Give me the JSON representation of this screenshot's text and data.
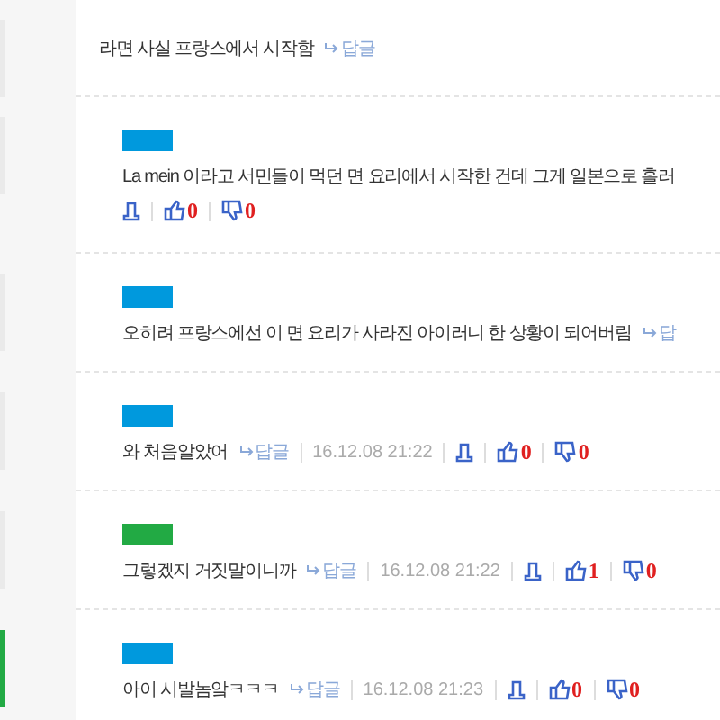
{
  "comments": [
    {
      "kind": "inline",
      "highlighted": false,
      "text": "라면 사실 프랑스에서 시작함",
      "reply": "답글",
      "children": [
        {
          "kind": "below",
          "highlighted": false,
          "color": "#0099dd",
          "text": "La mein 이라고 서민들이 먹던 면 요리에서 시작한 건데 그게 일본으로 흘러",
          "likes": "0",
          "dislikes": "0"
        },
        {
          "kind": "inline",
          "highlighted": false,
          "color": "#0099dd",
          "text": "오히려 프랑스에선 이 면 요리가 사라진 아이러니 한 상황이 되어버림",
          "reply": "답"
        },
        {
          "kind": "inline",
          "highlighted": false,
          "color": "#0099dd",
          "text": "와 처음알았어",
          "reply": "답글",
          "date": "16.12.08 21:22",
          "likes": "0",
          "dislikes": "0"
        },
        {
          "kind": "inline",
          "highlighted": false,
          "color": "#22aa44",
          "text": "그렇겠지 거짓말이니까",
          "reply": "답글",
          "date": "16.12.08 21:22",
          "likes": "1",
          "dislikes": "0"
        },
        {
          "kind": "inline",
          "highlighted": true,
          "color": "#0099dd",
          "text": "아이 시발놈앜ㅋㅋㅋ",
          "reply": "답글",
          "date": "16.12.08 21:23",
          "likes": "0",
          "dislikes": "0"
        }
      ]
    }
  ]
}
